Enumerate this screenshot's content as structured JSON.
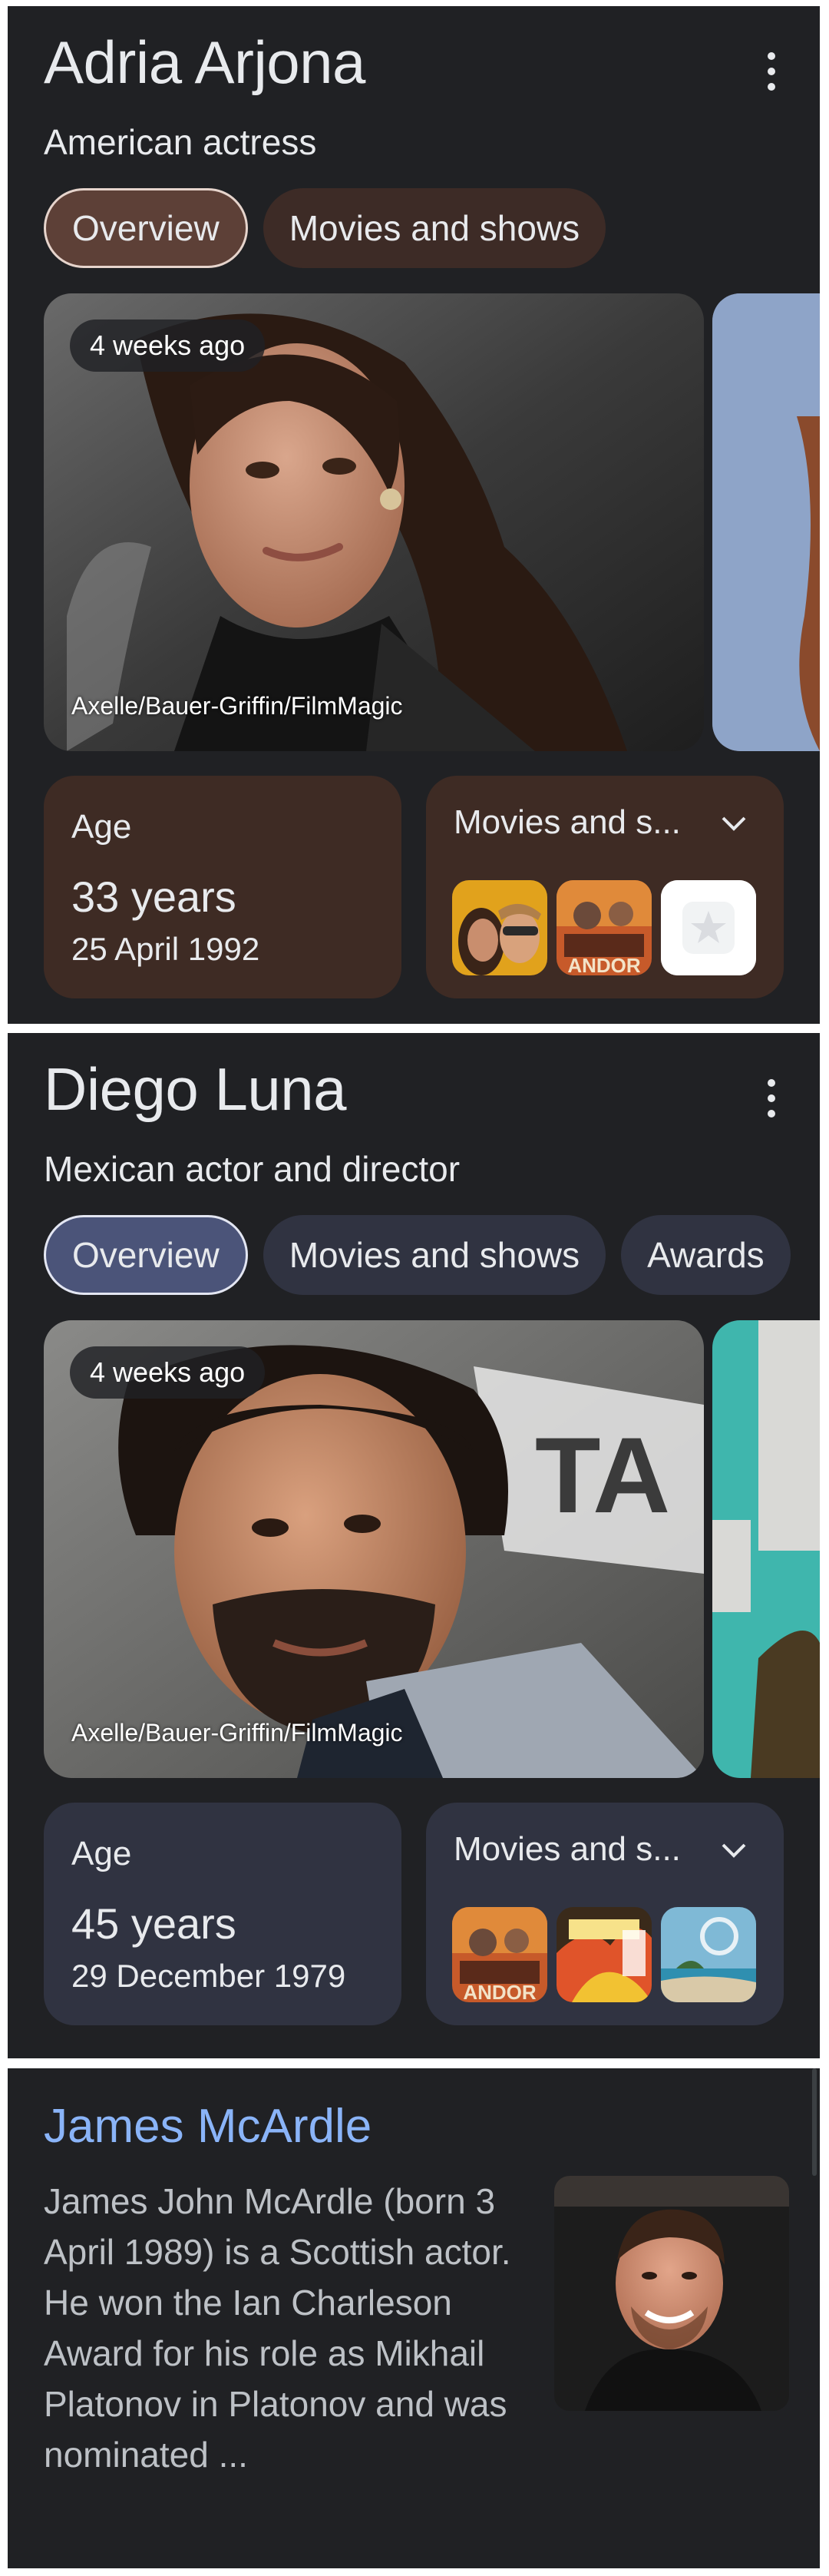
{
  "panels": [
    {
      "name": "Adria Arjona",
      "subtitle": "American actress",
      "chips": [
        "Overview",
        "Movies and shows"
      ],
      "photo": {
        "time": "4 weeks ago",
        "credit": "Axelle/Bauer-Griffin/FilmMagic"
      },
      "age_card": {
        "label": "Age",
        "value": "33 years",
        "date": "25 April 1992"
      },
      "movies_card": {
        "label": "Movies and s..."
      }
    },
    {
      "name": "Diego Luna",
      "subtitle": "Mexican actor and director",
      "chips": [
        "Overview",
        "Movies and shows",
        "Awards"
      ],
      "photo": {
        "time": "4 weeks ago",
        "credit": "Axelle/Bauer-Griffin/FilmMagic"
      },
      "age_card": {
        "label": "Age",
        "value": "45 years",
        "date": "29 December 1979"
      },
      "movies_card": {
        "label": "Movies and s..."
      }
    }
  ],
  "result": {
    "title": "James McArdle",
    "snippet": "James John McArdle (born 3 April 1989) is a Scottish actor. He won the Ian Charleson Award for his role as Mikhail Platonov in Platonov and was nominated ..."
  },
  "colors": {
    "panel_bg": "#202124",
    "brown_chip": "#5d4037",
    "slate_chip": "#4b5479",
    "link_blue": "#8ab4f8"
  },
  "icons": [
    "more-vert-icon",
    "chevron-down-icon",
    "star-placeholder-icon"
  ]
}
